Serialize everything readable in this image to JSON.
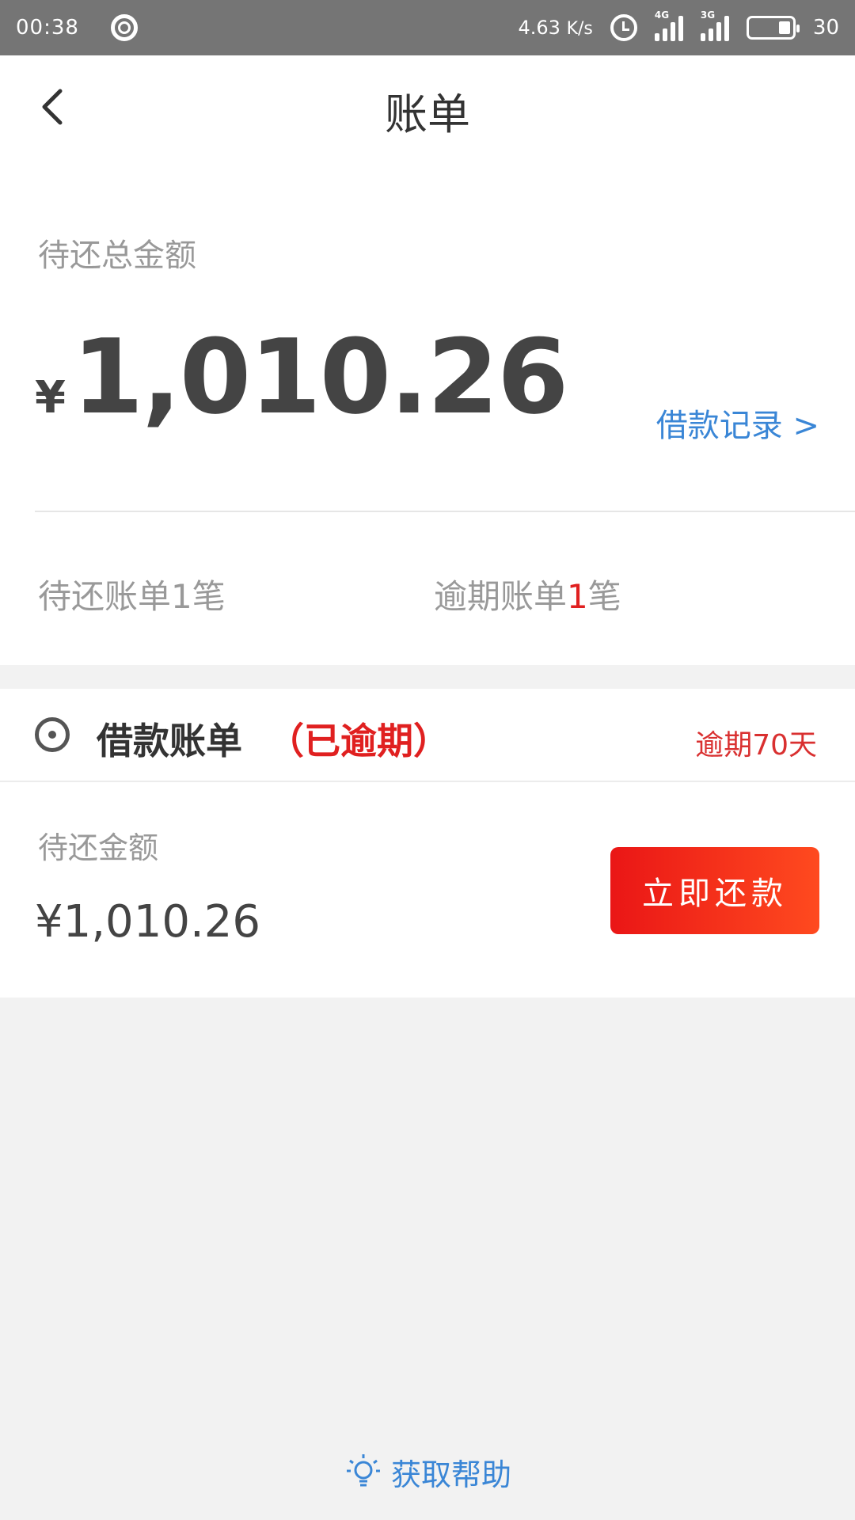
{
  "status_bar": {
    "time": "00:38",
    "speed_value": "4.63",
    "speed_unit": "K/s",
    "net_4g": "4G",
    "net_3g": "3G",
    "battery_level": "30"
  },
  "header": {
    "title": "账单"
  },
  "summary": {
    "total_label": "待还总金额",
    "currency": "¥",
    "total_amount": "1,010.26",
    "records_link": "借款记录 >",
    "pending_prefix": "待还账单",
    "pending_count": "1",
    "pending_suffix": "笔",
    "overdue_prefix": "逾期账单",
    "overdue_count": "1",
    "overdue_suffix": "笔"
  },
  "loan_card": {
    "title": "借款账单",
    "status": "（已逾期）",
    "overdue_days": "逾期70天",
    "due_label": "待还金额",
    "due_amount": "¥1,010.26",
    "repay_button": "立即还款"
  },
  "help": {
    "label": "获取帮助"
  },
  "colors": {
    "accent_blue": "#3a86d6",
    "alert_red": "#e02020",
    "button_gradient": [
      "#ea1616",
      "#ff4a1f"
    ]
  }
}
